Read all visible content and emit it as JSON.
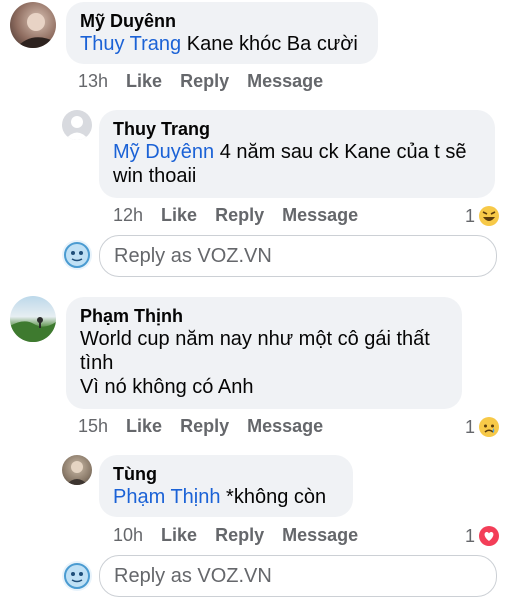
{
  "comments": [
    {
      "name": "Mỹ Duyênn",
      "mention": "Thuy Trang",
      "text": " Kane khóc Ba cười",
      "time": "13h",
      "like": "Like",
      "reply": "Reply",
      "message": "Message"
    },
    {
      "name": "Thuy Trang",
      "mention": "Mỹ Duyênn",
      "text_line1": " 4 năm sau ck Kane của t sẽ",
      "text_line2": "win thoaii",
      "time": "12h",
      "like": "Like",
      "reply": "Reply",
      "message": "Message",
      "reaction_count": "1",
      "reaction_icon": "laugh-emoji"
    },
    {
      "name": "Phạm Thịnh",
      "text_line1": "World cup năm nay như một cô gái thất",
      "text_line2": "tình",
      "text_line3": "Vì nó không có Anh",
      "time": "15h",
      "like": "Like",
      "reply": "Reply",
      "message": "Message",
      "reaction_count": "1",
      "reaction_icon": "sad-emoji"
    },
    {
      "name": "Tùng",
      "mention": "Phạm Thịnh",
      "text": " *không còn",
      "time": "10h",
      "like": "Like",
      "reply": "Reply",
      "message": "Message",
      "reaction_count": "1",
      "reaction_icon": "heart-emoji"
    }
  ],
  "reply_boxes": [
    {
      "placeholder": "Reply as VOZ.VN"
    },
    {
      "placeholder": "Reply as VOZ.VN"
    }
  ],
  "colors": {
    "mention": "#1b62d6",
    "bubble": "#f0f2f5",
    "meta": "#65676b"
  }
}
